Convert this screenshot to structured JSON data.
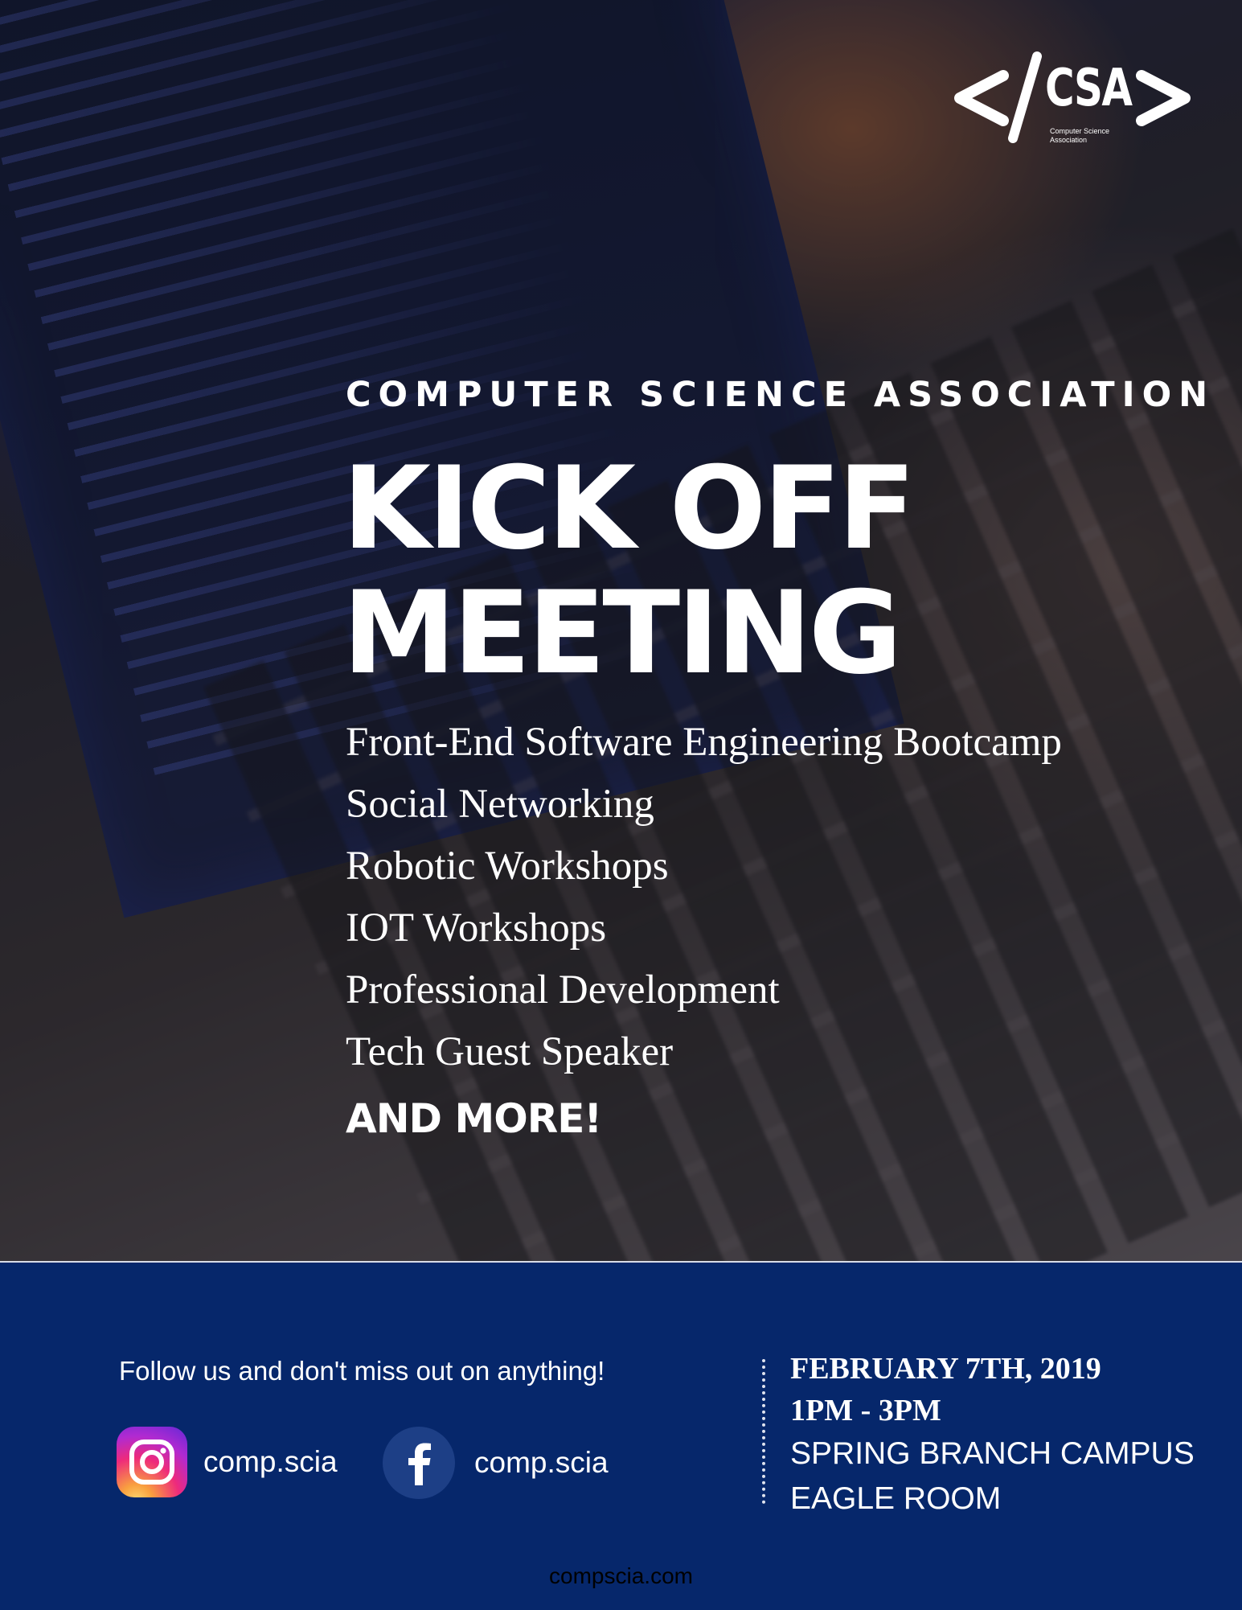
{
  "logo": {
    "wordmark": "CSA",
    "subtitle": "Computer Science Association"
  },
  "hero": {
    "organization": "COMPUTER SCIENCE ASSOCIATION",
    "title_line1": "KICK OFF",
    "title_line2": "MEETING",
    "activities": [
      "Front-End Software Engineering Bootcamp",
      "Social Networking",
      "Robotic Workshops",
      "IOT Workshops",
      "Professional Development",
      "Tech Guest Speaker"
    ],
    "more": "AND MORE!"
  },
  "footer": {
    "follow_text": "Follow us and don't miss out on anything!",
    "social": [
      {
        "platform_icon": "instagram-icon",
        "handle": "comp.scia"
      },
      {
        "platform_icon": "facebook-icon",
        "handle": "comp.scia"
      }
    ],
    "event": {
      "date": "FEBRUARY 7TH, 2019",
      "time": "1PM - 3PM",
      "location_line1": "SPRING BRANCH CAMPUS",
      "location_line2": "EAGLE ROOM"
    },
    "website": "compscia.com"
  },
  "colors": {
    "footer_background": "#06276b",
    "facebook_circle": "#1d3f86",
    "text": "#ffffff"
  }
}
